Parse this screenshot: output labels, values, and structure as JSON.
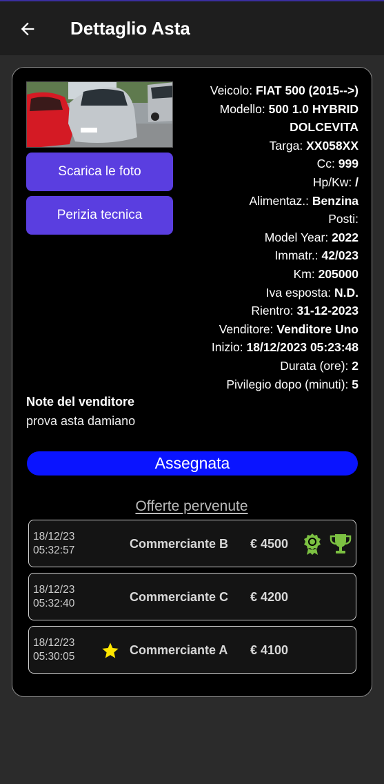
{
  "appbar": {
    "title": "Dettaglio Asta"
  },
  "buttons": {
    "download_photos": "Scarica le foto",
    "technical_report": "Perizia tecnica"
  },
  "vehicle": {
    "veicolo_label": "Veicolo:",
    "veicolo_value": "FIAT 500 (2015-->)",
    "modello_label": "Modello:",
    "modello_value": "500 1.0 HYBRID DOLCEVITA",
    "targa_label": "Targa:",
    "targa_value": "XX058XX",
    "cc_label": "Cc:",
    "cc_value": "999",
    "hpkw_label": "Hp/Kw:",
    "hpkw_value": "/",
    "alimentaz_label": "Alimentaz.:",
    "alimentaz_value": "Benzina",
    "posti_label": "Posti:",
    "posti_value": "",
    "model_year_label": "Model Year:",
    "model_year_value": "2022",
    "immatr_label": "Immatr.:",
    "immatr_value": "42/023",
    "km_label": "Km:",
    "km_value": "205000",
    "iva_label": "Iva esposta:",
    "iva_value": "N.D.",
    "rientro_label": "Rientro:",
    "rientro_value": "31-12-2023",
    "venditore_label": "Venditore:",
    "venditore_value": "Venditore Uno",
    "inizio_label": "Inizio:",
    "inizio_value": "18/12/2023 05:23:48",
    "durata_label": "Durata (ore):",
    "durata_value": "2",
    "privilegio_label": "Pivilegio dopo (minuti):",
    "privilegio_value": "5"
  },
  "notes": {
    "title": "Note del venditore",
    "text": "prova asta damiano"
  },
  "status": {
    "label": "Assegnata",
    "color": "#0a14ff"
  },
  "offers": {
    "title": "Offerte pervenute",
    "items": [
      {
        "date": "18/12/23",
        "time": "05:32:57",
        "dealer": "Commerciante B",
        "amount": "€ 4500",
        "icons": [
          "award-icon",
          "trophy-icon"
        ]
      },
      {
        "date": "18/12/23",
        "time": "05:32:40",
        "dealer": "Commerciante C",
        "amount": "€ 4200",
        "icons": []
      },
      {
        "date": "18/12/23",
        "time": "05:30:05",
        "dealer": "Commerciante A",
        "amount": "€ 4100",
        "icons": [
          "star-icon"
        ]
      }
    ]
  },
  "colors": {
    "accent_button": "#5a3ee0",
    "icon_green": "#7cc142",
    "star_yellow": "#ffe600"
  }
}
